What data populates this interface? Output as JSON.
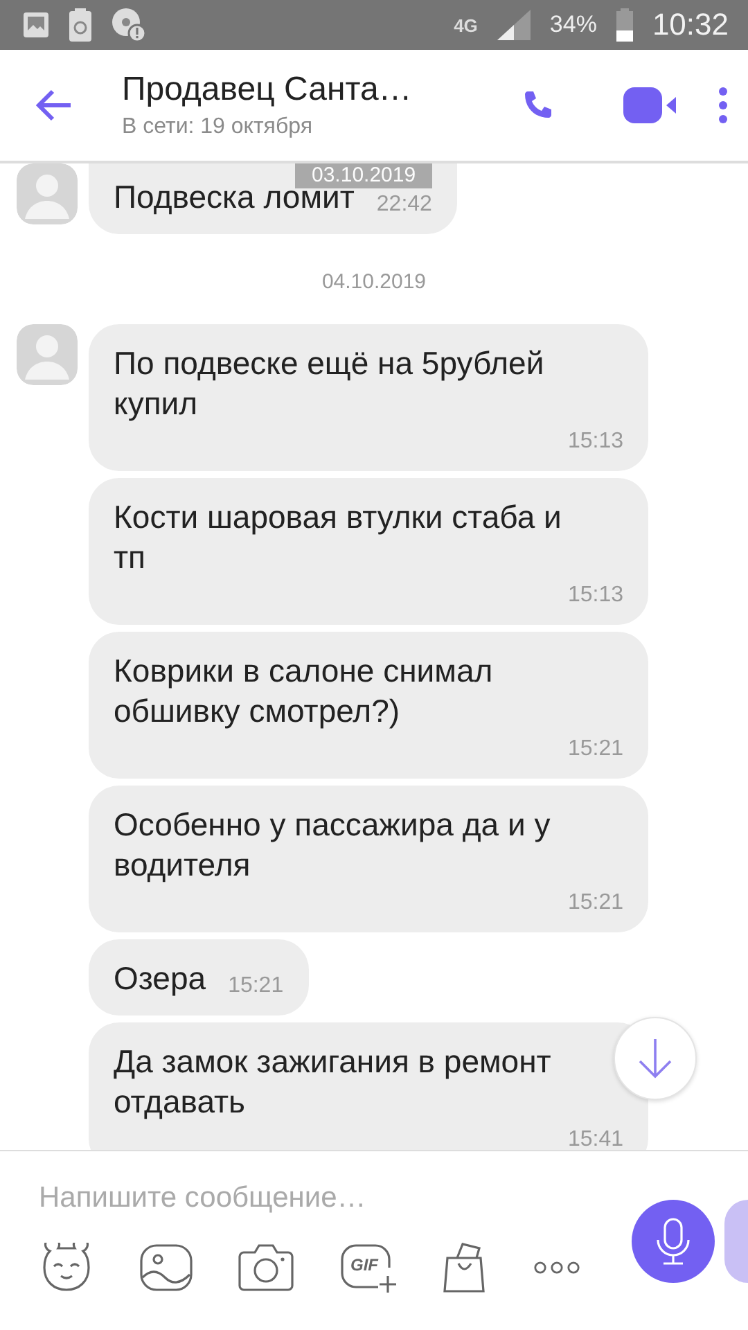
{
  "status_bar": {
    "network": "4G",
    "battery": "34%",
    "time": "10:32"
  },
  "header": {
    "title": "Продавец Санта…",
    "subtitle": "В сети: 19 октября"
  },
  "sticky_date": "03.10.2019",
  "messages": [
    {
      "kind": "message",
      "avatar": true,
      "text": "Подвеска ломит",
      "time": "22:42"
    },
    {
      "kind": "date",
      "text": "04.10.2019"
    },
    {
      "kind": "message",
      "avatar": true,
      "text": "По подвеске ещё на 5рублей купил",
      "time": "15:13"
    },
    {
      "kind": "message",
      "avatar": false,
      "text": "Кости шаровая втулки стаба и тп",
      "time": "15:13"
    },
    {
      "kind": "message",
      "avatar": false,
      "text": "Коврики в салоне снимал обшивку смотрел?)",
      "time": "15:21"
    },
    {
      "kind": "message",
      "avatar": false,
      "text": "Особенно у пассажира да и у водителя",
      "time": "15:21"
    },
    {
      "kind": "message",
      "avatar": false,
      "text": "Озера",
      "time": "15:21"
    },
    {
      "kind": "message",
      "avatar": false,
      "text": "Да замок зажигания в ремонт отдавать",
      "time": "15:41"
    }
  ],
  "composer": {
    "placeholder": "Напишите сообщение…",
    "gif_label": "GIF"
  }
}
